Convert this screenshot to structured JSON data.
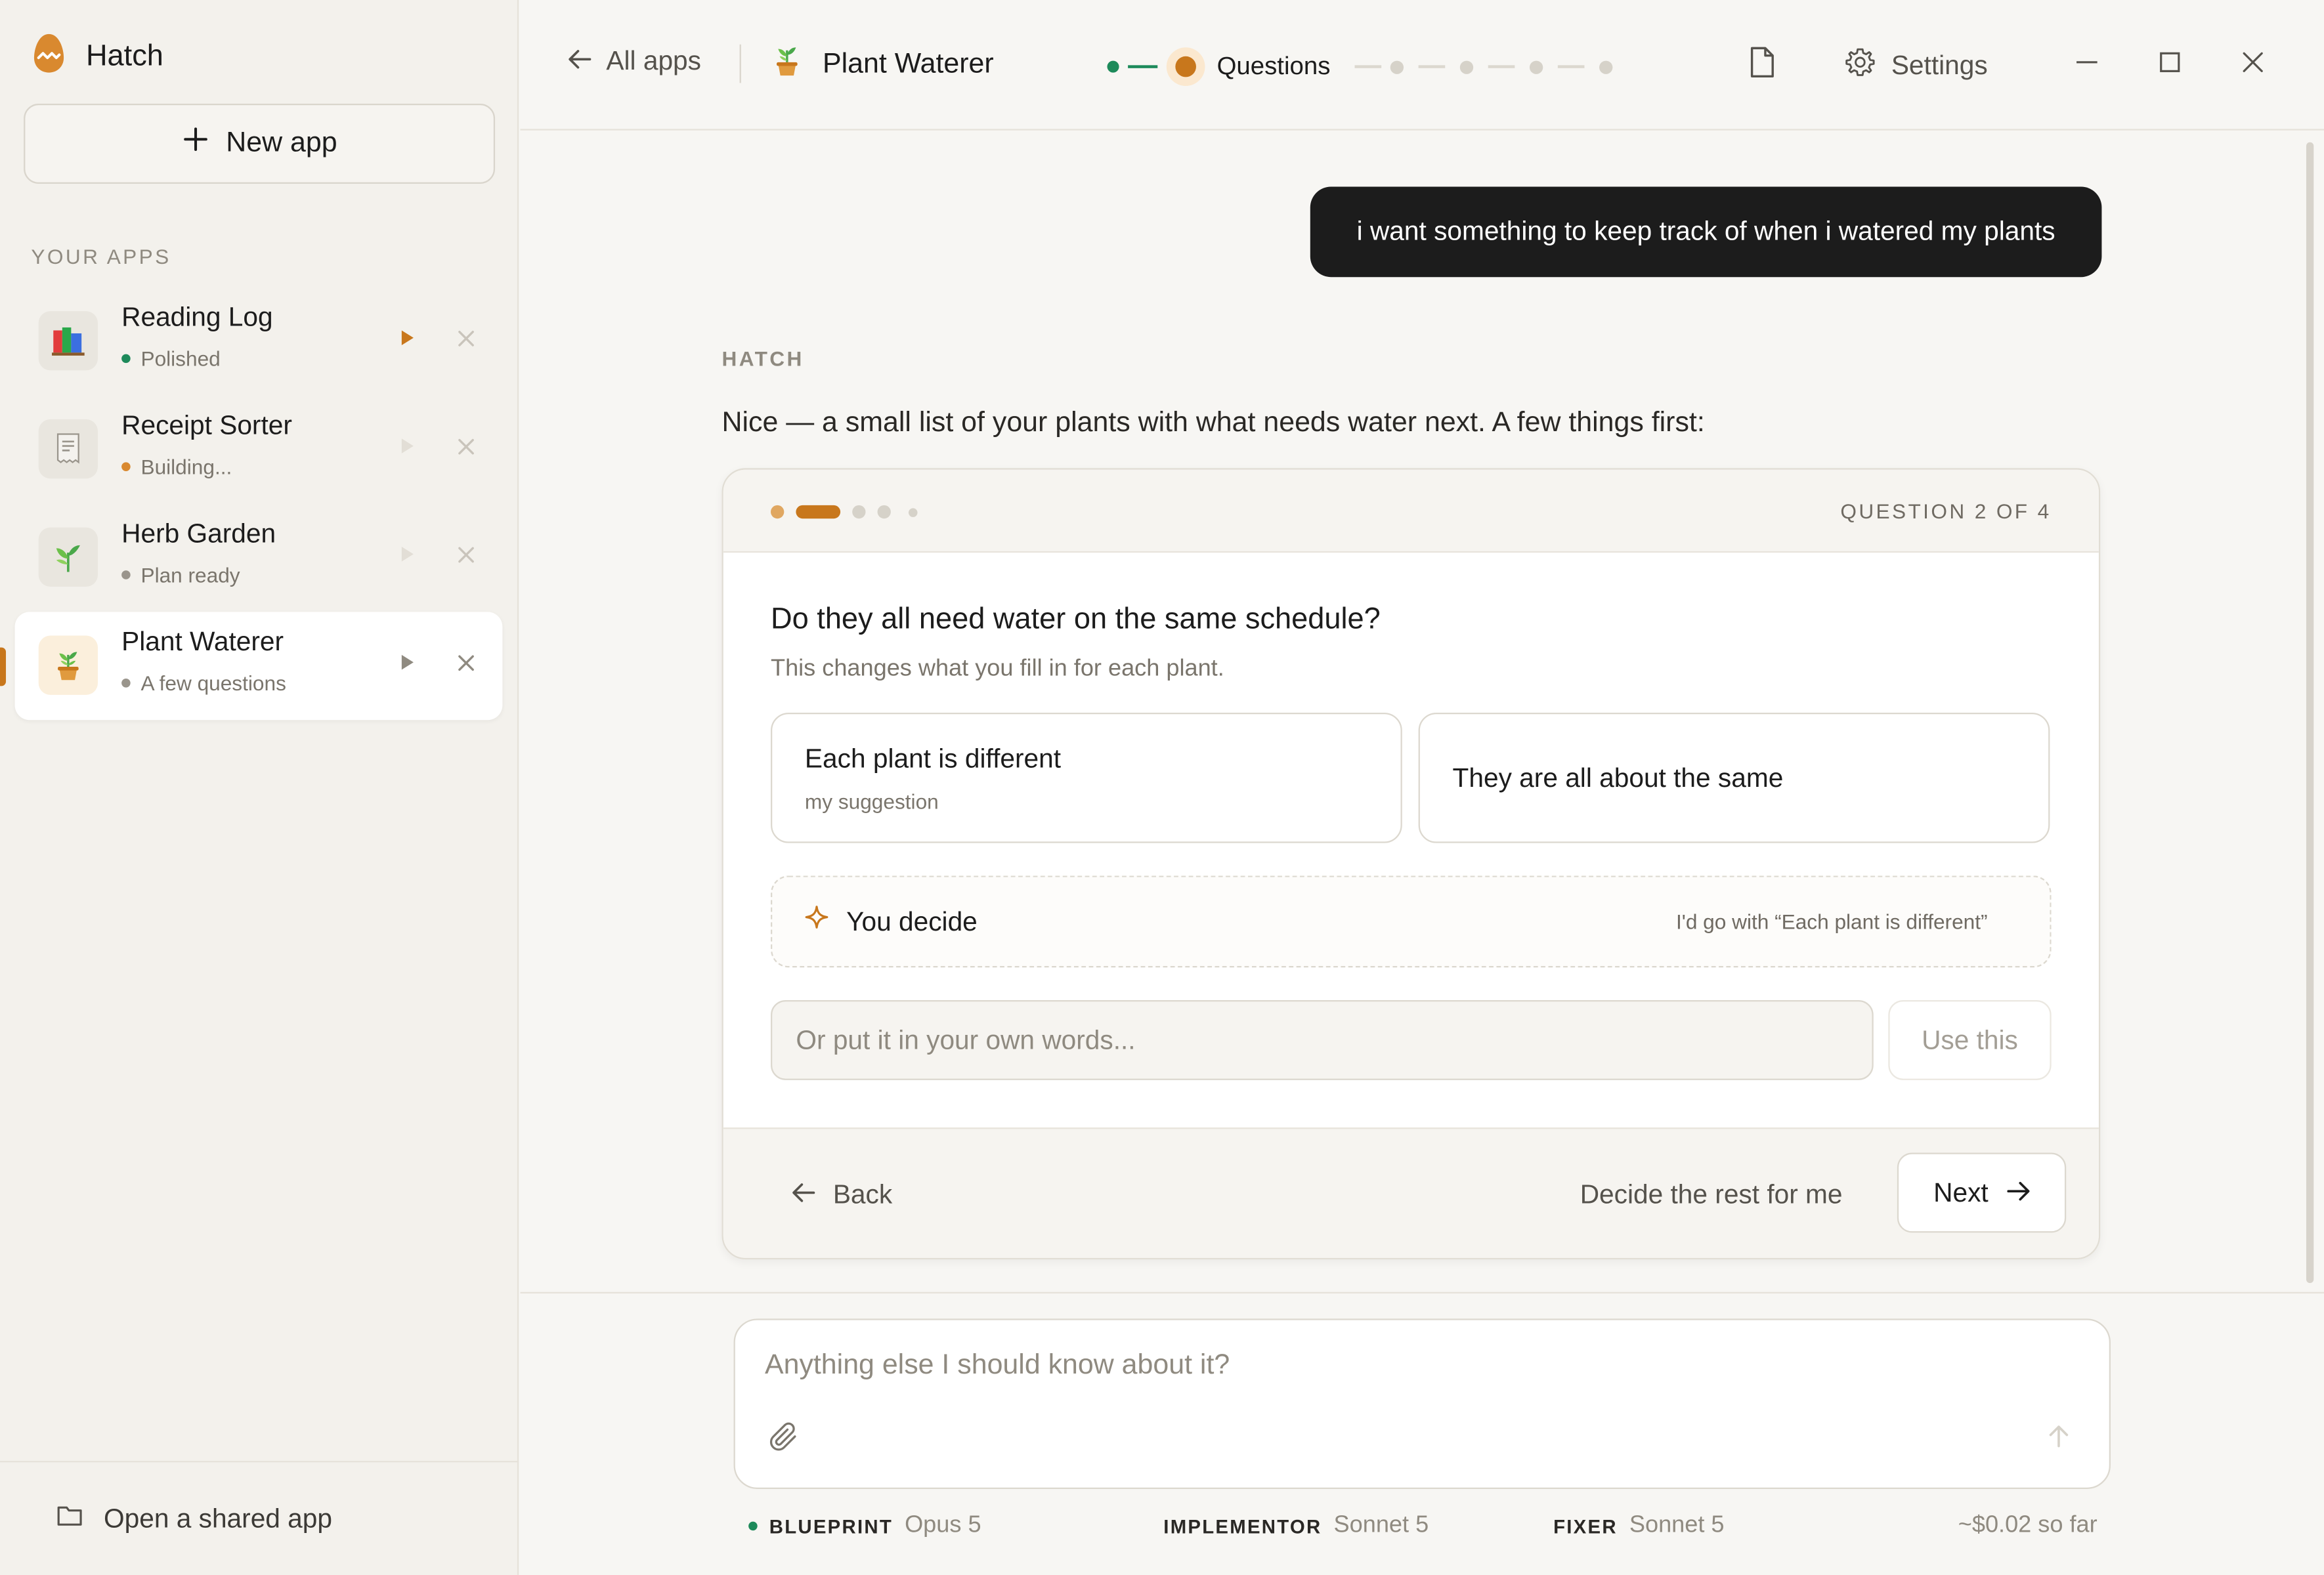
{
  "brand": {
    "name": "Hatch"
  },
  "sidebar": {
    "new_app_label": "New app",
    "section_label": "YOUR APPS",
    "apps": [
      {
        "name": "Reading Log",
        "status": "Polished",
        "status_color": "#1d8a5a",
        "icon": "books-icon"
      },
      {
        "name": "Receipt Sorter",
        "status": "Building...",
        "status_color": "#d9892f",
        "icon": "receipt-icon"
      },
      {
        "name": "Herb Garden",
        "status": "Plan ready",
        "status_color": "#9a958c",
        "icon": "herb-icon"
      },
      {
        "name": "Plant Waterer",
        "status": "A few questions",
        "status_color": "#9a958c",
        "icon": "potted-plant-icon"
      }
    ],
    "open_shared_label": "Open a shared app"
  },
  "topbar": {
    "all_apps_label": "All apps",
    "current_app": "Plant Waterer",
    "current_step": "Questions",
    "settings_label": "Settings"
  },
  "chat": {
    "user_message": "i want something to keep track of when i watered my plants",
    "assistant_label": "HATCH",
    "assistant_message": "Nice — a small list of your plants with what needs water next. A few things first:"
  },
  "question": {
    "counter": "QUESTION 2 OF 4",
    "current": 2,
    "total": 4,
    "title": "Do they all need water on the same schedule?",
    "subtitle": "This changes what you fill in for each plant.",
    "options": [
      {
        "label": "Each plant is different",
        "note": "my suggestion"
      },
      {
        "label": "They are all about the same",
        "note": ""
      }
    ],
    "you_decide_label": "You decide",
    "you_decide_hint": "I'd go with “Each plant is different”",
    "own_words_placeholder": "Or put it in your own words...",
    "use_this_label": "Use this",
    "back_label": "Back",
    "decide_rest_label": "Decide the rest for me",
    "next_label": "Next"
  },
  "composer": {
    "placeholder": "Anything else I should know about it?"
  },
  "models": {
    "blueprint_role": "BLUEPRINT",
    "blueprint_model": "Opus 5",
    "implementor_role": "IMPLEMENTOR",
    "implementor_model": "Sonnet 5",
    "fixer_role": "FIXER",
    "fixer_model": "Sonnet 5",
    "cost": "~$0.02 so far"
  },
  "colors": {
    "accent": "#c8771c",
    "success": "#1d8a5a",
    "dark": "#1c1c1c"
  }
}
